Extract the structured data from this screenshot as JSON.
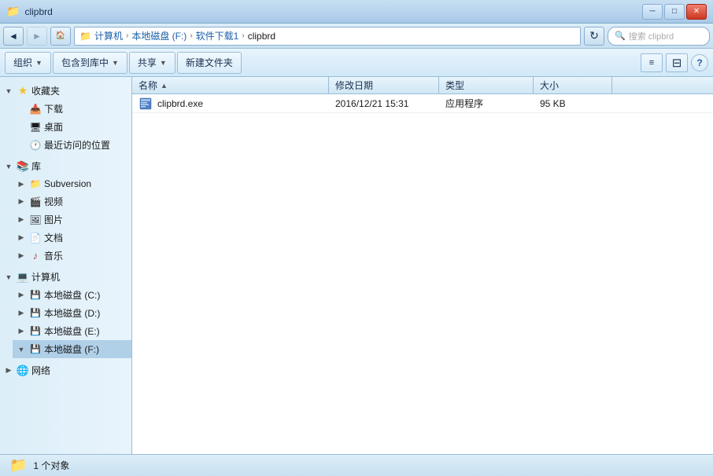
{
  "window": {
    "title": "clipbrd",
    "controls": {
      "minimize": "─",
      "maximize": "□",
      "close": "✕"
    }
  },
  "addressBar": {
    "back": "◄",
    "forward": "►",
    "up": "▲",
    "refresh": "↻",
    "breadcrumb": [
      "计算机",
      "本地磁盘 (F:)",
      "软件下载1",
      "clipbrd"
    ],
    "searchPlaceholder": "搜索 clipbrd",
    "searchIcon": "🔍"
  },
  "toolbar": {
    "organize": "组织",
    "includeInLibrary": "包含到库中",
    "share": "共享",
    "newFolder": "新建文件夹",
    "help": "?"
  },
  "sidebar": {
    "favorites": {
      "label": "收藏夹",
      "icon": "★",
      "items": [
        {
          "label": "下载",
          "icon": "📥"
        },
        {
          "label": "桌面",
          "icon": "🖥"
        },
        {
          "label": "最近访问的位置",
          "icon": "🕐"
        }
      ]
    },
    "library": {
      "label": "库",
      "icon": "📚",
      "items": [
        {
          "label": "Subversion",
          "icon": "📁"
        },
        {
          "label": "视频",
          "icon": "🎬"
        },
        {
          "label": "图片",
          "icon": "🖼"
        },
        {
          "label": "文档",
          "icon": "📄"
        },
        {
          "label": "音乐",
          "icon": "♪"
        }
      ]
    },
    "computer": {
      "label": "计算机",
      "icon": "💻",
      "items": [
        {
          "label": "本地磁盘 (C:)",
          "icon": "💾"
        },
        {
          "label": "本地磁盘 (D:)",
          "icon": "💾"
        },
        {
          "label": "本地磁盘 (E:)",
          "icon": "💾"
        },
        {
          "label": "本地磁盘 (F:)",
          "icon": "💾",
          "selected": true
        }
      ]
    },
    "network": {
      "label": "网络",
      "icon": "🌐"
    }
  },
  "fileList": {
    "columns": {
      "name": "名称",
      "date": "修改日期",
      "type": "类型",
      "size": "大小",
      "sortArrow": "▲"
    },
    "files": [
      {
        "name": "clipbrd.exe",
        "icon": "📋",
        "date": "2016/12/21 15:31",
        "type": "应用程序",
        "size": "95 KB"
      }
    ]
  },
  "statusBar": {
    "icon": "📁",
    "text": "1 个对象"
  }
}
